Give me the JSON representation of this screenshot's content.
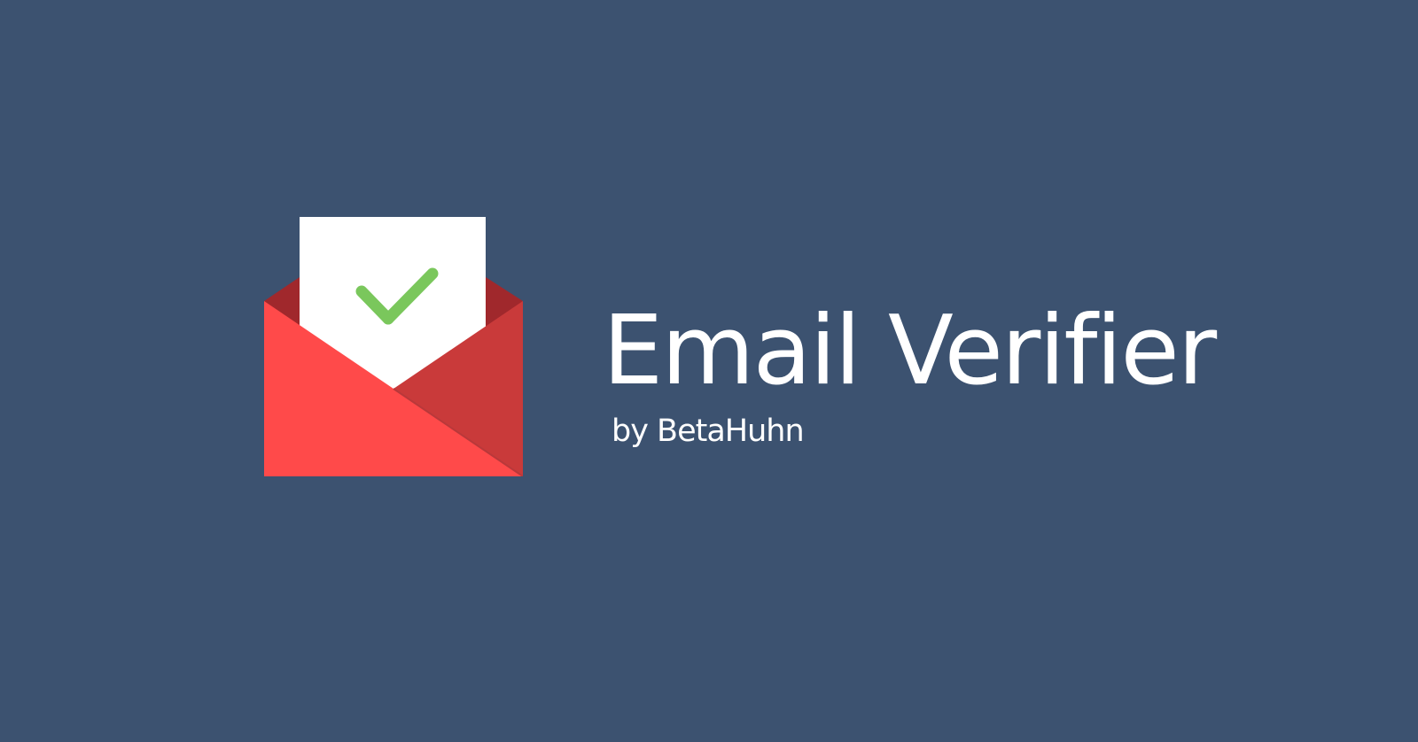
{
  "branding": {
    "title": "Email Verifier",
    "subtitle": "by BetaHuhn",
    "logo_icon": "envelope-check-icon"
  },
  "colors": {
    "background": "#3c5270",
    "text": "#ffffff",
    "envelope_red": "#ff4a4a",
    "envelope_dark_red": "#a0282c",
    "envelope_shadow_red": "#c93a3a",
    "paper": "#ffffff",
    "checkmark": "#7ac75c"
  }
}
